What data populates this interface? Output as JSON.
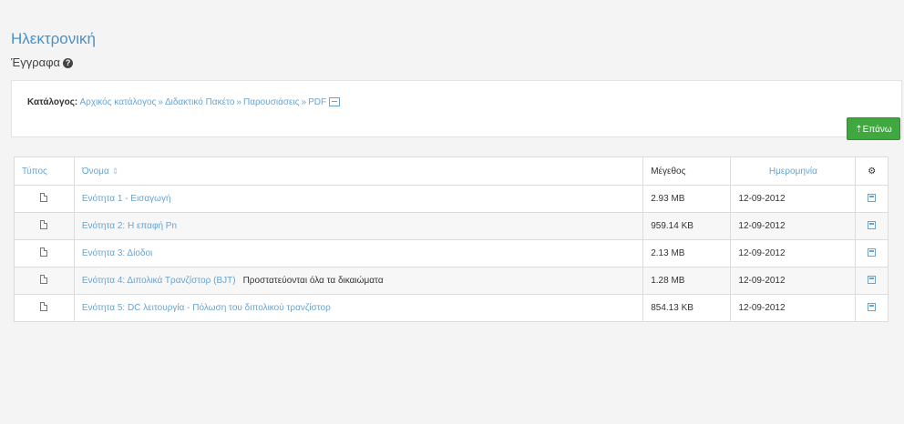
{
  "header": {
    "course_title": "Ηλεκτρονική",
    "section_title": "Έγγραφα",
    "help_icon": "?"
  },
  "directory": {
    "label": "Κατάλογος:",
    "path": [
      "Αρχικός κατάλογος",
      "Διδακτικό Πακέτο",
      "Παρουσιάσεις",
      "PDF"
    ],
    "separator": "»",
    "up_button_label": "⇡Επάνω"
  },
  "table": {
    "headers": {
      "type": "Τύπος",
      "name": "Όνομα",
      "sort_icon": "⇕",
      "size": "Μέγεθος",
      "date": "Ημερομηνία",
      "actions_icon": "⚙"
    },
    "rows": [
      {
        "name": "Ενότητα 1 - Εισαγωγή",
        "description": "",
        "size": "2.93 MB",
        "date": "12-09-2012"
      },
      {
        "name": "Ενότητα 2: Η επαφή Pn",
        "description": "",
        "size": "959.14 KB",
        "date": "12-09-2012"
      },
      {
        "name": "Ενότητα 3: Δίοδοι",
        "description": "",
        "size": "2.13 MB",
        "date": "12-09-2012"
      },
      {
        "name": "Ενότητα 4: Διπολικά Τρανζίστορ (BJT)",
        "description": "Προστατεύονται όλα τα δικαιώματα",
        "size": "1.28 MB",
        "date": "12-09-2012"
      },
      {
        "name": "Ενότητα 5: DC λειτουργία - Πόλωση του διπολικού τρανζίστορ",
        "description": "",
        "size": "854.13 KB",
        "date": "12-09-2012"
      }
    ]
  }
}
